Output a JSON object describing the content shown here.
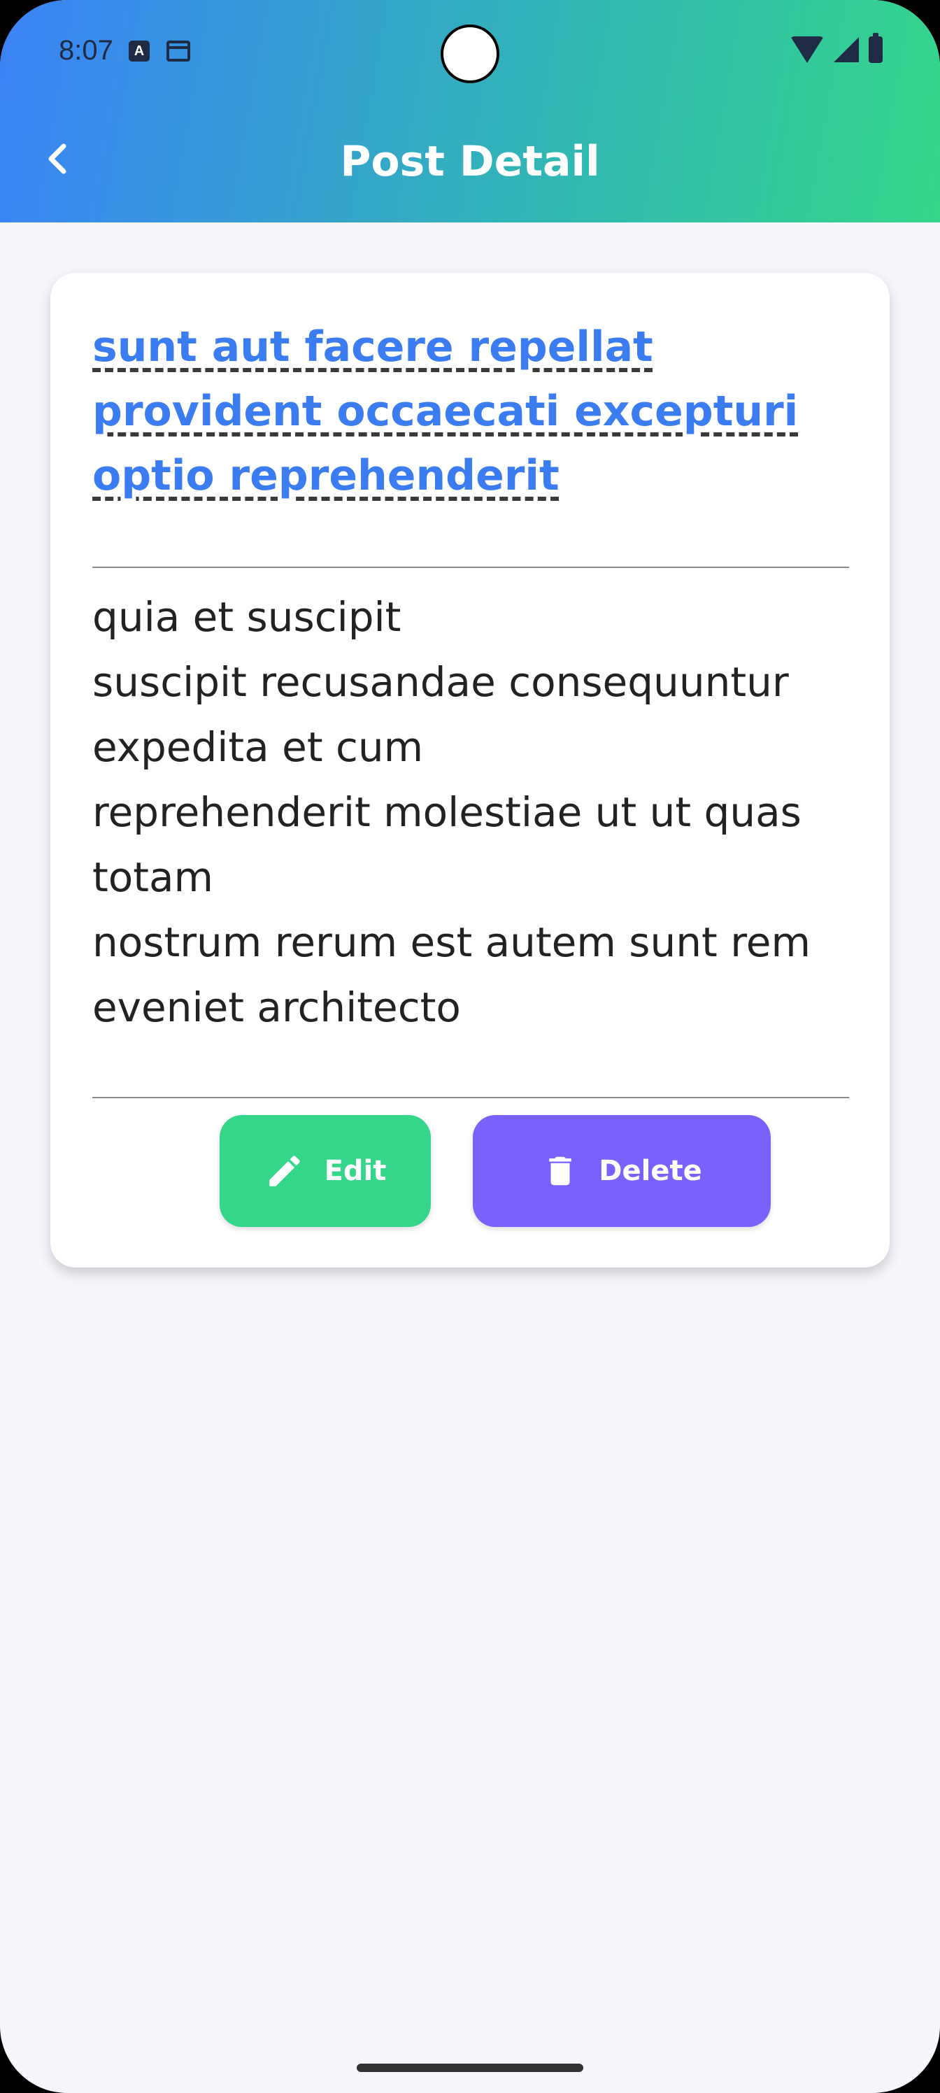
{
  "status_bar": {
    "time": "8:07",
    "left_icons": [
      "a-icon",
      "calendar-icon"
    ],
    "right_icons": [
      "wifi-icon",
      "signal-icon",
      "battery-icon"
    ]
  },
  "header": {
    "title": "Post Detail",
    "back_icon": "chevron-left-icon"
  },
  "post": {
    "title": "sunt aut facere repellat provident occaecati excepturi optio reprehenderit",
    "body": "quia et suscipit\nsuscipit recusandae consequuntur expedita et cum\nreprehenderit molestiae ut ut quas totam\nnostrum rerum est autem sunt rem eveniet architecto"
  },
  "actions": {
    "edit_label": "Edit",
    "delete_label": "Delete"
  },
  "colors": {
    "gradient_start": "#3a82f7",
    "gradient_end": "#34d68a",
    "title_link": "#3b7cf0",
    "edit_button": "#34d68a",
    "delete_button": "#7b61fb",
    "background": "#f6f6fc"
  }
}
